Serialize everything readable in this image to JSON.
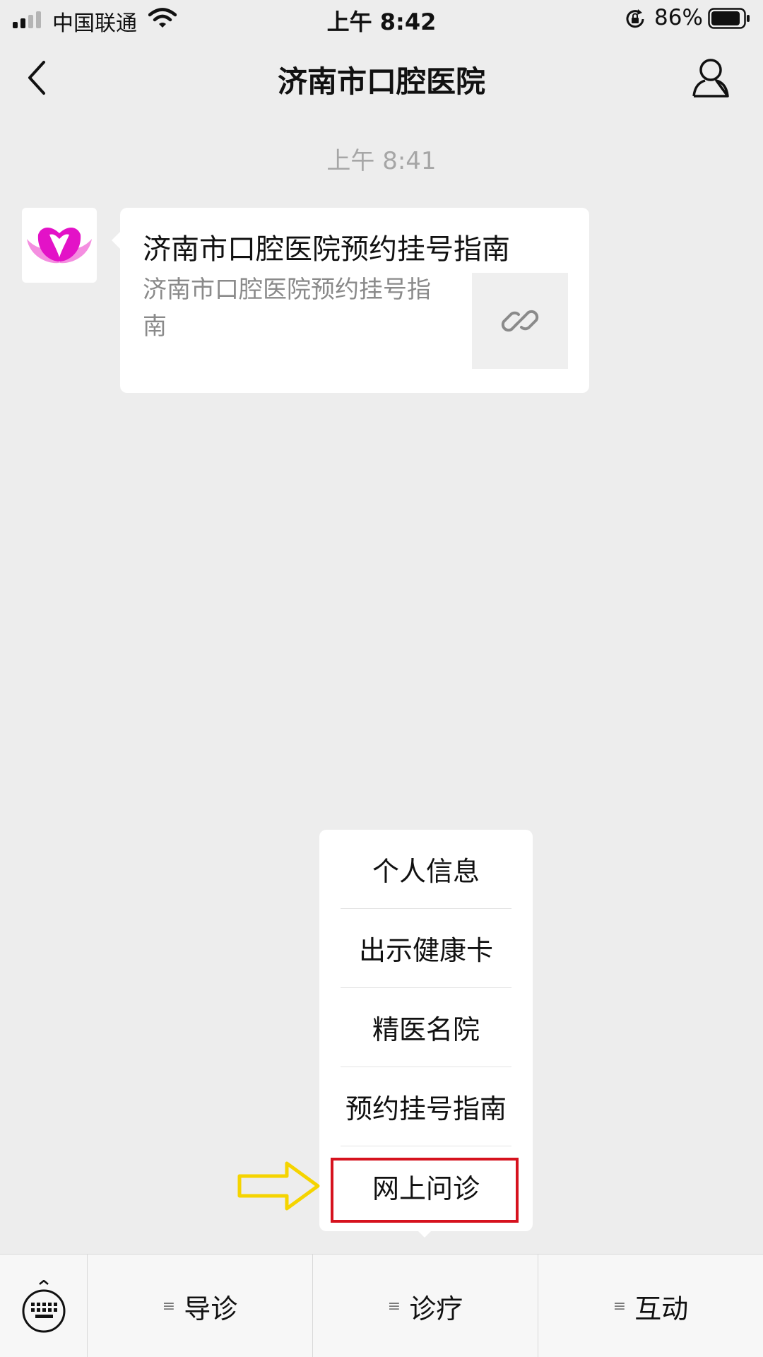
{
  "status": {
    "carrier": "中国联通",
    "time": "上午 8:42",
    "battery": "86%"
  },
  "nav": {
    "title": "济南市口腔医院"
  },
  "chat": {
    "timestamp": "上午 8:41",
    "card": {
      "title": "济南市口腔医院预约挂号指南",
      "description": "济南市口腔医院预约挂号指南"
    }
  },
  "popup_menu": {
    "items": [
      "个人信息",
      "出示健康卡",
      "精医名院",
      "预约挂号指南",
      "网上问诊"
    ],
    "highlight_color": "#d6121e",
    "arrow_color": "#f5d400"
  },
  "bottom_menu": {
    "tabs": [
      "导诊",
      "诊疗",
      "互动"
    ],
    "menu_glyph": "≡"
  },
  "icons": [
    "signal-icon",
    "wifi-icon",
    "rotation-lock-icon",
    "battery-icon",
    "back-chevron-icon",
    "profile-icon",
    "hospital-logo-icon",
    "link-icon",
    "keyboard-icon",
    "arrow-pointer-icon"
  ]
}
